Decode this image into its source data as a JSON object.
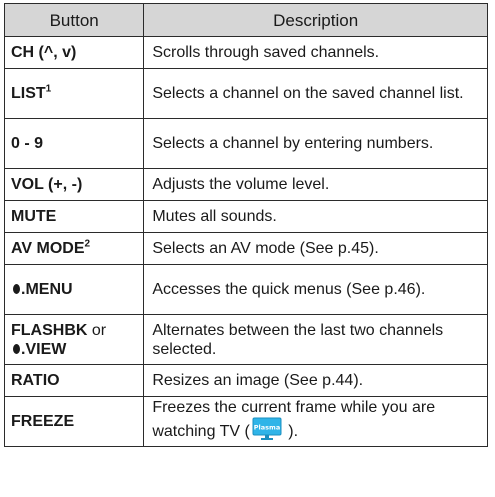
{
  "header": {
    "button": "Button",
    "description": "Description"
  },
  "rows": [
    {
      "button": "CH (^, v)",
      "description": "Scrolls through saved channels."
    },
    {
      "button": "LIST",
      "sup": "1",
      "description": "Selects a channel on the saved channel list."
    },
    {
      "button": "0 - 9",
      "description": "Selects a channel by entering numbers."
    },
    {
      "button": "VOL (+, -)",
      "description": "Adjusts the volume level."
    },
    {
      "button": "MUTE",
      "description": "Mutes all sounds."
    },
    {
      "button": "AV MODE",
      "sup": "2",
      "description": "Selects an AV mode (See p.45)."
    },
    {
      "button": ".MENU",
      "description": "Accesses the quick menus (See p.46)."
    },
    {
      "button": "FLASHBK",
      "button_or": "or",
      "button_line2": ".VIEW",
      "description": "Alternates between the last two channels selected."
    },
    {
      "button": "RATIO",
      "description": "Resizes an image (See p.44)."
    },
    {
      "button": "FREEZE",
      "description_before": "Freezes the current frame while you are watching TV (",
      "icon_label": "Plasma",
      "description_after": " )."
    }
  ],
  "colors": {
    "header_bg": "#d6d6d6",
    "border": "#2b2b2b",
    "plasma_icon": "#2fb4e8"
  }
}
